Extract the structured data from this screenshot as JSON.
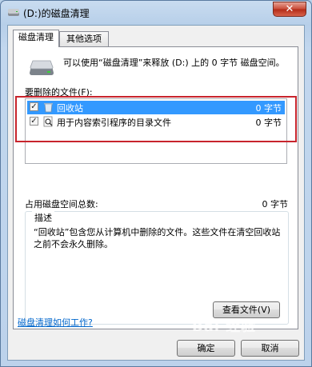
{
  "window": {
    "title": "(D:)的磁盘清理",
    "close_symbol": "✕"
  },
  "tabs": [
    {
      "label": "磁盘清理"
    },
    {
      "label": "其他选项"
    }
  ],
  "summary": "可以使用“磁盘清理”来释放  (D:) 上的 0 字节 磁盘空间。",
  "files_label": "要删除的文件(F):",
  "files": [
    {
      "label": "回收站",
      "size": "0 字节",
      "checked": true,
      "selected": true,
      "icon": "recycle-bin-icon"
    },
    {
      "label": "用于内容索引程序的目录文件",
      "size": "0 字节",
      "checked": true,
      "selected": false,
      "icon": "search-catalog-icon"
    }
  ],
  "total": {
    "label": "占用磁盘空间总数:",
    "value": "0 字节"
  },
  "description": {
    "title": "描述",
    "text": "“回收站”包含您从计算机中删除的文件。这些文件在清空回收站之前不会永久删除。"
  },
  "view_files_button": "查看文件(V)",
  "help_link": "磁盘清理如何工作?",
  "ok_button": "确定",
  "cancel_button": "取消",
  "watermark": "Bai 经验",
  "colors": {
    "selection": "#3399ff",
    "highlight_frame": "#c8242c",
    "link": "#0066cc"
  }
}
